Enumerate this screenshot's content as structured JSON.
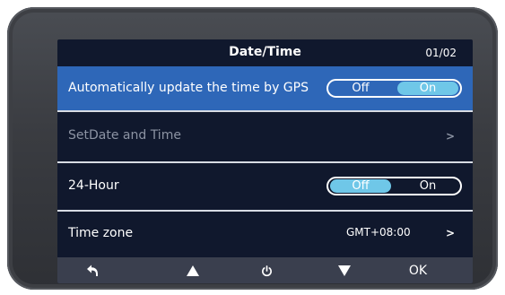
{
  "header": {
    "title": "Date/Time",
    "page": "01/02"
  },
  "rows": [
    {
      "label": "Automatically update the time by GPS",
      "toggle": {
        "off": "Off",
        "on": "On",
        "selected": "On"
      }
    },
    {
      "label": "SetDate and Time",
      "arrow": ">"
    },
    {
      "label": "24-Hour",
      "toggle": {
        "off": "Off",
        "on": "On",
        "selected": "Off"
      }
    },
    {
      "label": "Time zone",
      "value": "GMT+08:00",
      "arrow": ">"
    }
  ],
  "bottom_bar": {
    "back_icon": "back-arrow-icon",
    "up_icon": "triangle-up-icon",
    "power_icon": "power-icon",
    "down_icon": "triangle-down-icon",
    "ok_label": "OK"
  },
  "colors": {
    "screen_bg": "#10182d",
    "selected_row": "#2e67b8",
    "toggle_active": "#6fc7e8",
    "bottom_bar": "#3a3f4e",
    "bezel": "#3a3c41"
  }
}
